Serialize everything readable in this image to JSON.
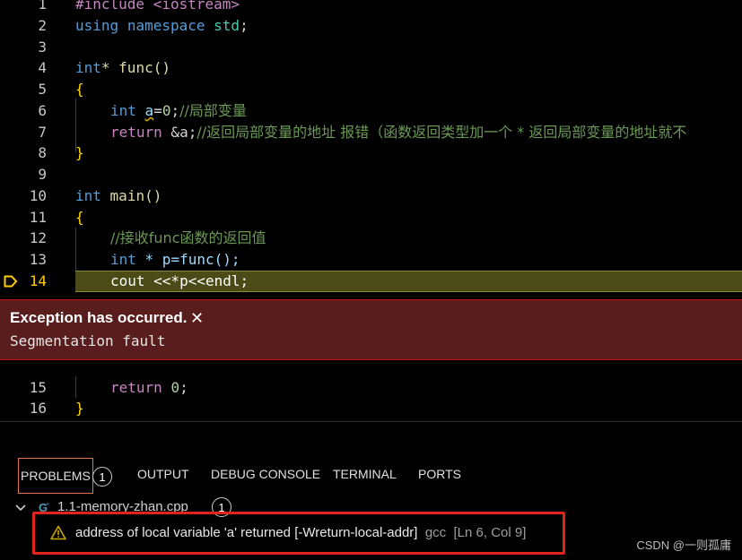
{
  "editor": {
    "lines": [
      {
        "n": "1"
      },
      {
        "n": "2"
      },
      {
        "n": "3"
      },
      {
        "n": "4"
      },
      {
        "n": "5"
      },
      {
        "n": "6"
      },
      {
        "n": "7"
      },
      {
        "n": "8"
      },
      {
        "n": "9"
      },
      {
        "n": "10"
      },
      {
        "n": "11"
      },
      {
        "n": "12"
      },
      {
        "n": "13"
      },
      {
        "n": "14"
      },
      {
        "n": "15"
      },
      {
        "n": "16"
      }
    ],
    "code": {
      "l1_pp": "#include <iostream>",
      "l2_using": "using",
      "l2_namespace": "namespace",
      "l2_std": "std",
      "l4_int": "int",
      "l4_rest": "* func()",
      "l6_int": "int",
      "l6_var": "a",
      "l6_num": "0",
      "l6_comment": "//局部变量",
      "l7_return": "return",
      "l7_rest": " &a;",
      "l7_comment": "//返回局部变量的地址 报错（函数返回类型加一个 * 返回局部变量的地址就不",
      "l10_int": "int",
      "l10_main": "main()",
      "l12_comment": "//接收func函数的返回值",
      "l13_int": "int",
      "l13_rest": " * p=func();",
      "l14_code": "cout <<*p<<endl;",
      "l15_return": "return",
      "l15_num": "0",
      "brace_open": "{",
      "brace_close": "}"
    }
  },
  "exception": {
    "title": "Exception has occurred.",
    "close_glyph": "✕",
    "message": "Segmentation fault"
  },
  "panel": {
    "tabs": {
      "problems": "PROBLEMS",
      "problems_count": "1",
      "output": "OUTPUT",
      "debug_console": "DEBUG CONSOLE",
      "terminal": "TERMINAL",
      "ports": "PORTS"
    },
    "file": {
      "name": "1.1-memory-zhan.cpp",
      "count": "1"
    },
    "problem": {
      "message": "address of local variable 'a' returned [-Wreturn-local-addr]",
      "source": "gcc",
      "location": "[Ln 6, Col 9]"
    }
  },
  "watermark": "CSDN @一则孤庸",
  "colors": {
    "exception_bg": "#5a1d1d",
    "current_line": "#4b4b18",
    "highlight_border": "#e0241c",
    "warning": "#cca700"
  },
  "icons": [
    "breakpoint-arrow-icon",
    "close-icon",
    "chevron-down-icon",
    "cpp-file-icon",
    "warning-icon"
  ]
}
